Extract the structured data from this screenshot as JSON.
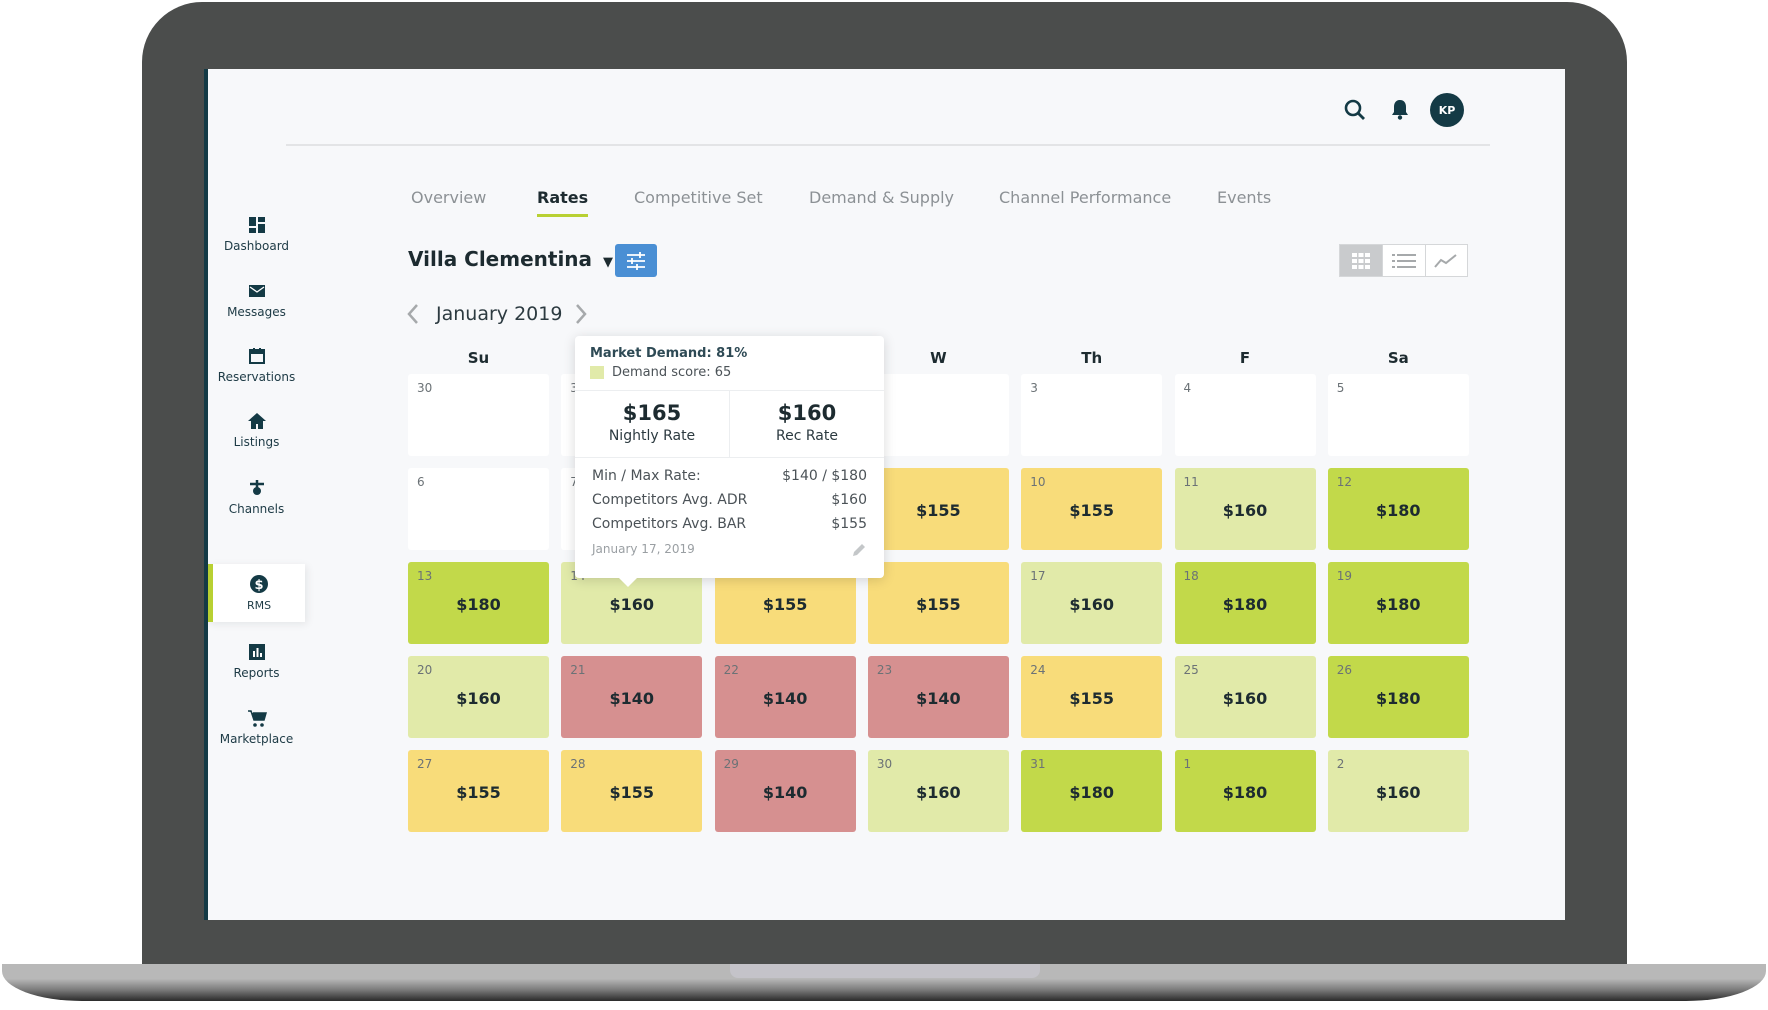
{
  "header": {
    "avatar_initials": "KP",
    "icons": [
      "search-icon",
      "bell-icon"
    ]
  },
  "tabs": [
    {
      "label": "Overview",
      "active": false
    },
    {
      "label": "Rates",
      "active": true
    },
    {
      "label": "Competitive Set",
      "active": false
    },
    {
      "label": "Demand & Supply",
      "active": false
    },
    {
      "label": "Channel Performance",
      "active": false
    },
    {
      "label": "Events",
      "active": false
    }
  ],
  "sidebar": {
    "items": [
      {
        "label": "Dashboard",
        "icon": "dashboard-icon"
      },
      {
        "label": "Messages",
        "icon": "envelope-icon"
      },
      {
        "label": "Reservations",
        "icon": "calendar-icon"
      },
      {
        "label": "Listings",
        "icon": "home-icon"
      },
      {
        "label": "Channels",
        "icon": "channels-icon"
      },
      {
        "label": "RMS",
        "icon": "dollar-icon",
        "active": true
      },
      {
        "label": "Reports",
        "icon": "bar-chart-icon"
      },
      {
        "label": "Marketplace",
        "icon": "cart-icon"
      }
    ]
  },
  "property": {
    "name": "Villa Clementina"
  },
  "calendar": {
    "month": "January 2019",
    "weekdays": [
      "Su",
      "",
      "",
      "W",
      "Th",
      "F",
      "Sa"
    ],
    "colors": {
      "white": "#ffffff",
      "red": "#d69090",
      "yellow": "#f8dc7a",
      "lightgreen": "#e1eaa9",
      "green": "#c2d94a"
    },
    "weeks": [
      [
        {
          "day": "30",
          "price": "",
          "level": "white"
        },
        {
          "day": "31",
          "price": "",
          "level": "white"
        },
        {
          "day": "",
          "price": "",
          "level": "white"
        },
        {
          "day": "",
          "price": "",
          "level": "white"
        },
        {
          "day": "3",
          "price": "",
          "level": "white"
        },
        {
          "day": "4",
          "price": "",
          "level": "white"
        },
        {
          "day": "5",
          "price": "",
          "level": "white"
        }
      ],
      [
        {
          "day": "6",
          "price": "",
          "level": "white"
        },
        {
          "day": "7",
          "price": "",
          "level": "white"
        },
        {
          "day": "",
          "price": "",
          "level": "white"
        },
        {
          "day": "",
          "price": "$155",
          "level": "yellow"
        },
        {
          "day": "10",
          "price": "$155",
          "level": "yellow"
        },
        {
          "day": "11",
          "price": "$160",
          "level": "lightgreen"
        },
        {
          "day": "12",
          "price": "$180",
          "level": "green"
        }
      ],
      [
        {
          "day": "13",
          "price": "$180",
          "level": "green"
        },
        {
          "day": "14",
          "price": "$160",
          "level": "lightgreen"
        },
        {
          "day": "",
          "price": "$155",
          "level": "yellow"
        },
        {
          "day": "",
          "price": "$155",
          "level": "yellow"
        },
        {
          "day": "17",
          "price": "$160",
          "level": "lightgreen"
        },
        {
          "day": "18",
          "price": "$180",
          "level": "green"
        },
        {
          "day": "19",
          "price": "$180",
          "level": "green"
        }
      ],
      [
        {
          "day": "20",
          "price": "$160",
          "level": "lightgreen"
        },
        {
          "day": "21",
          "price": "$140",
          "level": "red"
        },
        {
          "day": "22",
          "price": "$140",
          "level": "red"
        },
        {
          "day": "23",
          "price": "$140",
          "level": "red"
        },
        {
          "day": "24",
          "price": "$155",
          "level": "yellow"
        },
        {
          "day": "25",
          "price": "$160",
          "level": "lightgreen"
        },
        {
          "day": "26",
          "price": "$180",
          "level": "green"
        }
      ],
      [
        {
          "day": "27",
          "price": "$155",
          "level": "yellow"
        },
        {
          "day": "28",
          "price": "$155",
          "level": "yellow"
        },
        {
          "day": "29",
          "price": "$140",
          "level": "red"
        },
        {
          "day": "30",
          "price": "$160",
          "level": "lightgreen"
        },
        {
          "day": "31",
          "price": "$180",
          "level": "green"
        },
        {
          "day": "1",
          "price": "$180",
          "level": "green"
        },
        {
          "day": "2",
          "price": "$160",
          "level": "lightgreen"
        }
      ]
    ]
  },
  "tooltip": {
    "market_demand": "Market Demand: 81%",
    "demand_score": "Demand score: 65",
    "nightly_rate": "$165",
    "nightly_label": "Nightly Rate",
    "rec_rate": "$160",
    "rec_label": "Rec Rate",
    "rows": [
      {
        "label": "Min / Max Rate:",
        "value": "$140 / $180"
      },
      {
        "label": "Competitors Avg. ADR",
        "value": "$160"
      },
      {
        "label": "Competitors Avg. BAR",
        "value": "$155"
      }
    ],
    "date": "January 17, 2019"
  },
  "view_toggle": {
    "active": "calendar-grid"
  }
}
